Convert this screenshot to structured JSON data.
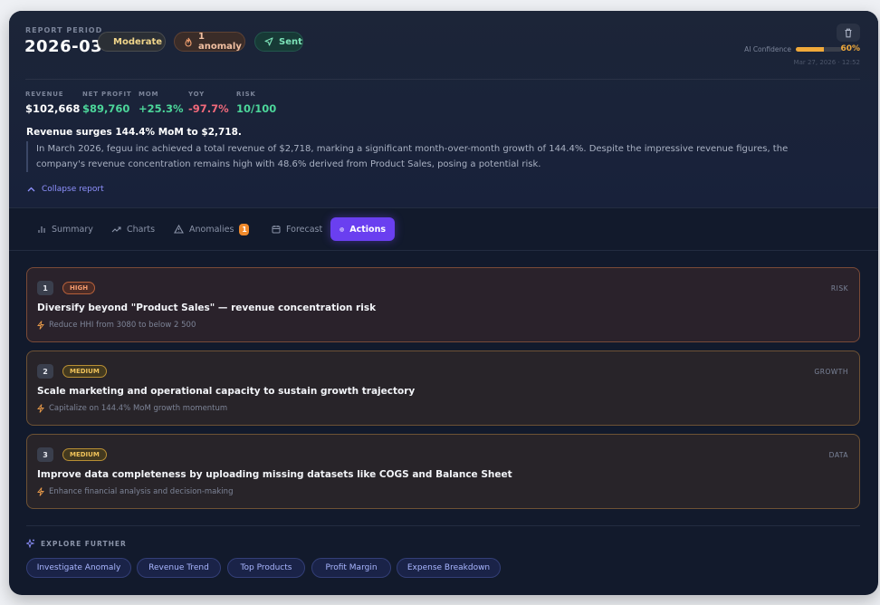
{
  "header": {
    "period_label": "REPORT PERIOD",
    "period_value": "2026-03",
    "badges": {
      "severity": "Moderate",
      "anomalies": "1 anomaly",
      "status": "Sent"
    },
    "confidence": {
      "label": "AI Confidence",
      "value_text": "60%",
      "value_fraction": 0.6
    },
    "timestamp": "Mar 27, 2026 · 12:52"
  },
  "metrics": [
    {
      "label": "REVENUE",
      "value": "$102,668",
      "color": "#ffffff"
    },
    {
      "label": "NET PROFIT",
      "value": "$89,760",
      "color": "#4cd69a"
    },
    {
      "label": "MOM",
      "value": "+25.3%",
      "color": "#4cd69a"
    },
    {
      "label": "YOY",
      "value": "-97.7%",
      "color": "#f0697a"
    },
    {
      "label": "RISK",
      "value": "10/100",
      "color": "#4cd69a"
    }
  ],
  "report": {
    "headline": "Revenue surges 144.4% MoM to $2,718.",
    "summary": "In March 2026, feguu inc achieved a total revenue of $2,718, marking a significant month-over-month growth of 144.4%. Despite the impressive revenue figures, the company's revenue concentration remains high with 48.6% derived from Product Sales, posing a potential risk.",
    "collapse_label": "Collapse report"
  },
  "tabs": [
    {
      "label": "Summary",
      "icon": "bar-chart-icon"
    },
    {
      "label": "Charts",
      "icon": "trend-line-icon"
    },
    {
      "label": "Anomalies",
      "icon": "warning-triangle-icon",
      "count": "1"
    },
    {
      "label": "Forecast",
      "icon": "calendar-icon"
    },
    {
      "label": "Actions",
      "icon": "target-icon",
      "active": true
    }
  ],
  "actions": [
    {
      "number": "1",
      "priority": "HIGH",
      "category": "RISK",
      "title": "Diversify beyond \"Product Sales\" — revenue concentration risk",
      "detail": "Reduce HHI from 3080 to below 2 500"
    },
    {
      "number": "2",
      "priority": "MEDIUM",
      "category": "GROWTH",
      "title": "Scale marketing and operational capacity to sustain growth trajectory",
      "detail": "Capitalize on 144.4% MoM growth momentum"
    },
    {
      "number": "3",
      "priority": "MEDIUM",
      "category": "DATA",
      "title": "Improve data completeness by uploading missing datasets like COGS and Balance Sheet",
      "detail": "Enhance financial analysis and decision-making"
    }
  ],
  "explore": {
    "label": "EXPLORE FURTHER",
    "chips": [
      "Investigate Anomaly",
      "Revenue Trend",
      "Top Products",
      "Profit Margin",
      "Expense Breakdown"
    ]
  },
  "colors": {
    "accent": "#6a3ff0",
    "positive": "#4cd69a",
    "negative": "#f0697a",
    "warning": "#f0a93a"
  }
}
